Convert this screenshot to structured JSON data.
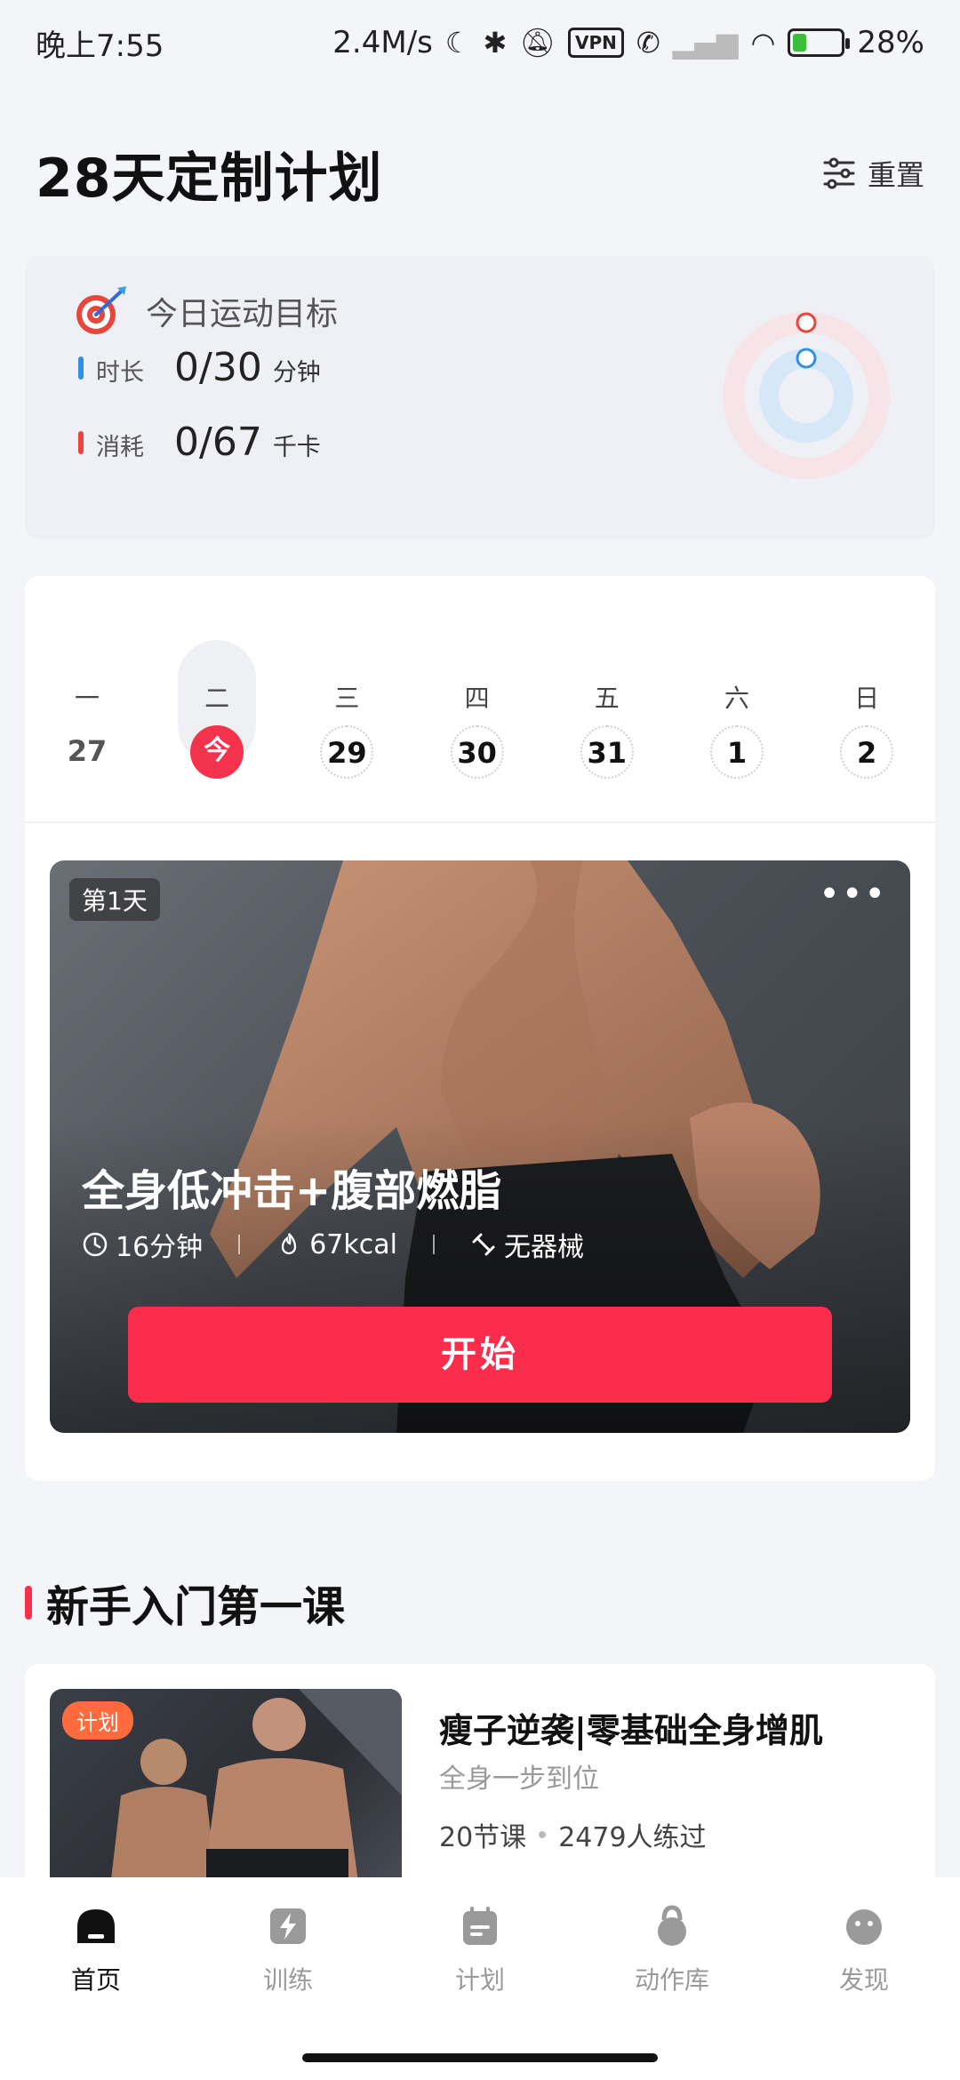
{
  "status_bar": {
    "time": "晚上7:55",
    "speed": "2.4M/s",
    "vpn": "VPN",
    "battery": "28%",
    "battery_level": 0.28,
    "icons": [
      "moon-icon",
      "bluetooth-icon",
      "mute-bell-icon",
      "vpn-icon",
      "call-forward-icon",
      "signal-icon",
      "wifi-icon",
      "battery-icon"
    ]
  },
  "header": {
    "title": "28天定制计划",
    "reset_label": "重置"
  },
  "goal": {
    "title": "今日运动目标",
    "duration": {
      "label": "时长",
      "value": "0/30",
      "unit": "分钟",
      "color": "#2f8fe8",
      "progress": 0
    },
    "calories": {
      "label": "消耗",
      "value": "0/67",
      "unit": "千卡",
      "color": "#e8453c",
      "progress": 0
    }
  },
  "calendar": {
    "days": [
      {
        "weekday": "一",
        "date": "27",
        "state": "past"
      },
      {
        "weekday": "二",
        "date": "今",
        "state": "today"
      },
      {
        "weekday": "三",
        "date": "29",
        "state": "future"
      },
      {
        "weekday": "四",
        "date": "30",
        "state": "future"
      },
      {
        "weekday": "五",
        "date": "31",
        "state": "future"
      },
      {
        "weekday": "六",
        "date": "1",
        "state": "future"
      },
      {
        "weekday": "日",
        "date": "2",
        "state": "future"
      }
    ]
  },
  "workout": {
    "day_tag": "第1天",
    "more": "•••",
    "title": "全身低冲击+腹部燃脂",
    "duration": "16分钟",
    "calories": "67kcal",
    "equipment": "无器械",
    "start_label": "开始"
  },
  "section": {
    "title": "新手入门第一课"
  },
  "course": {
    "tag": "计划",
    "title": "瘦子逆袭|零基础全身增肌",
    "subtitle": "全身一步到位",
    "lessons": "20节课",
    "participants": "2479人练过"
  },
  "tabbar": {
    "items": [
      {
        "label": "首页",
        "icon": "home-icon",
        "active": true
      },
      {
        "label": "训练",
        "icon": "lightning-icon",
        "active": false
      },
      {
        "label": "计划",
        "icon": "calendar-icon",
        "active": false
      },
      {
        "label": "动作库",
        "icon": "kettlebell-icon",
        "active": false
      },
      {
        "label": "发现",
        "icon": "discover-icon",
        "active": false
      }
    ]
  },
  "colors": {
    "accent": "#fb2d4c",
    "duration_blue": "#2f8fe8",
    "calorie_red": "#e8453c"
  }
}
